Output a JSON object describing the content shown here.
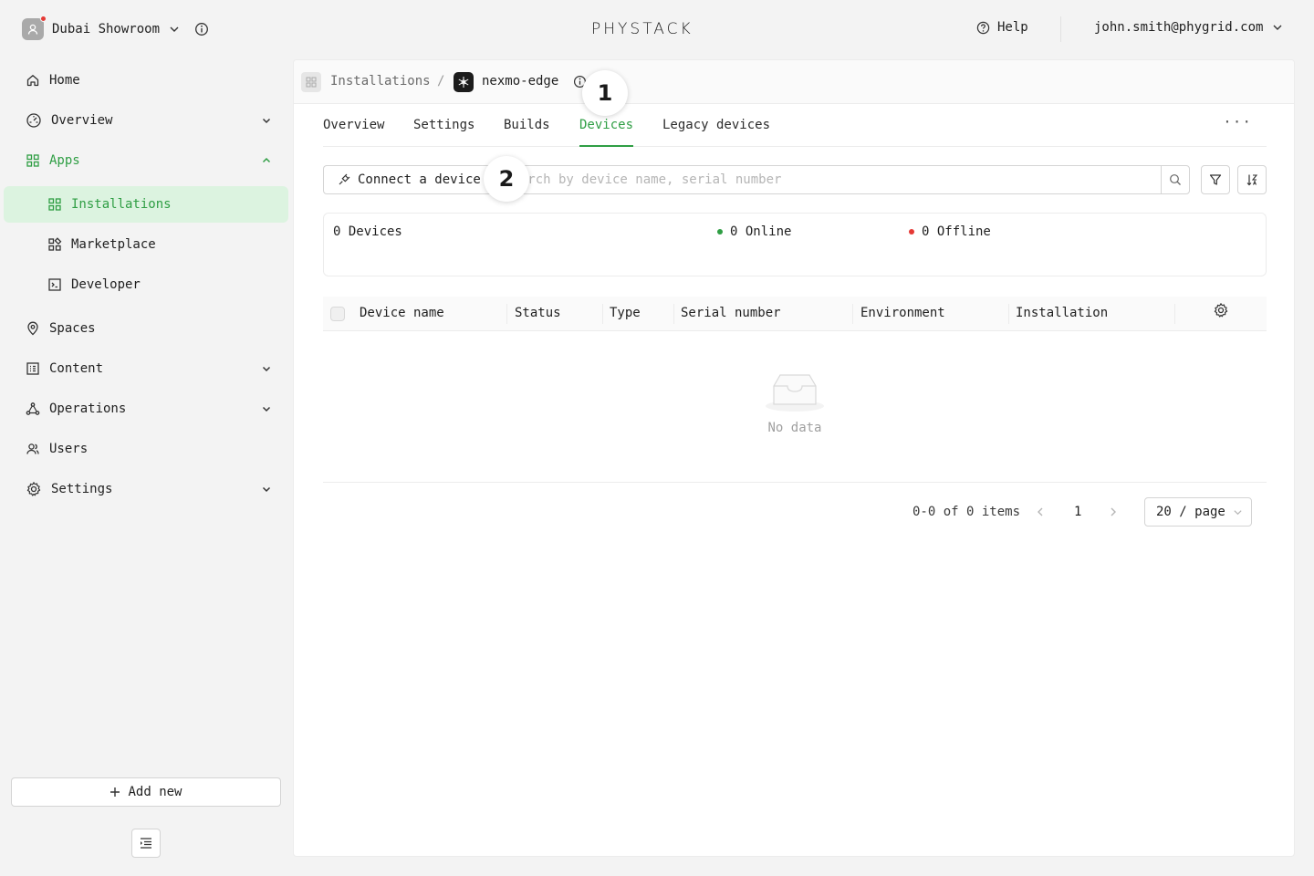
{
  "header": {
    "org_name": "Dubai Showroom",
    "logo_text": "PHYSTACK",
    "help_label": "Help",
    "user_email": "john.smith@phygrid.com"
  },
  "sidebar": {
    "items": [
      {
        "label": "Home",
        "icon": "home-icon"
      },
      {
        "label": "Overview",
        "icon": "dashboard-icon",
        "expandable": true
      },
      {
        "label": "Apps",
        "icon": "apps-grid-icon",
        "expandable": true,
        "expanded": true
      },
      {
        "label": "Installations",
        "icon": "apps-grid-icon",
        "selected": true
      },
      {
        "label": "Marketplace",
        "icon": "marketplace-icon"
      },
      {
        "label": "Developer",
        "icon": "terminal-icon"
      },
      {
        "label": "Spaces",
        "icon": "location-pin-icon"
      },
      {
        "label": "Content",
        "icon": "content-list-icon",
        "expandable": true
      },
      {
        "label": "Operations",
        "icon": "operations-nodes-icon",
        "expandable": true
      },
      {
        "label": "Users",
        "icon": "users-icon"
      },
      {
        "label": "Settings",
        "icon": "gear-icon",
        "expandable": true
      }
    ],
    "add_new_label": "Add new"
  },
  "breadcrumb": {
    "root": "Installations",
    "separator": "/",
    "current": "nexmo-edge"
  },
  "markers": [
    "1",
    "2"
  ],
  "tabs": [
    {
      "label": "Overview"
    },
    {
      "label": "Settings"
    },
    {
      "label": "Builds"
    },
    {
      "label": "Devices",
      "active": true
    },
    {
      "label": "Legacy devices"
    }
  ],
  "tabs_more": "···",
  "toolbar": {
    "connect_label": "Connect a device",
    "search_placeholder": "Search by device name, serial number"
  },
  "stats": {
    "devices": "0 Devices",
    "online": "0 Online",
    "offline": "0 Offline"
  },
  "table": {
    "columns": [
      "Device name",
      "Status",
      "Type",
      "Serial number",
      "Environment",
      "Installation"
    ],
    "empty_text": "No data"
  },
  "pagination": {
    "range": "0-0 of 0 items",
    "current_page": "1",
    "page_size": "20 / page"
  },
  "colors": {
    "accent": "#2f9e44",
    "selected_bg": "#dcf3e0",
    "online": "#2f9e44",
    "offline": "#e53935"
  }
}
